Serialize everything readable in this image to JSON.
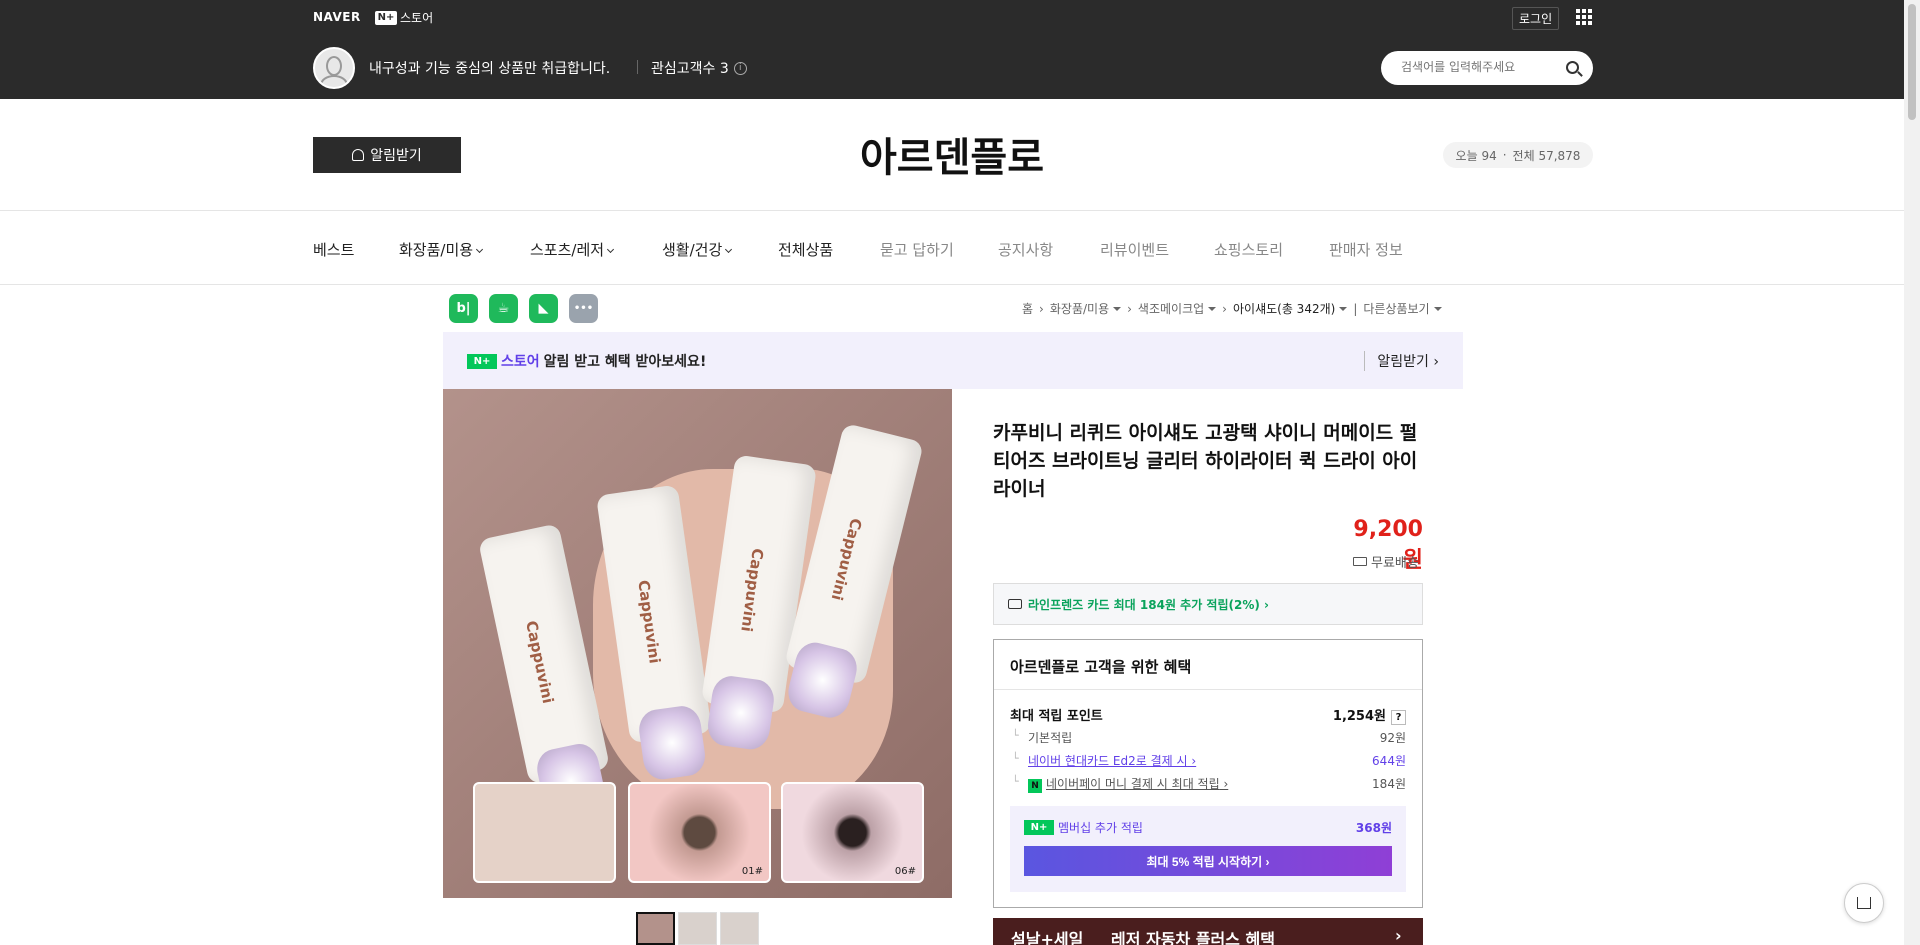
{
  "global": {
    "naver_label": "NAVER",
    "nplus_badge": "N+",
    "store_label": "스토어",
    "login_label": "로그인",
    "intro_text": "내구성과 기능 중심의 상품만 취급합니다.",
    "fans_text": "관심고객수 3",
    "search_placeholder": "검색어를 입력해주세요"
  },
  "store": {
    "notify_label": "알림받기",
    "name": "아르덴플로",
    "visits_today": "오늘 94",
    "visits_total": "전체 57,878"
  },
  "nav": [
    {
      "label": "베스트",
      "dropdown": false
    },
    {
      "label": "화장품/미용",
      "dropdown": true
    },
    {
      "label": "스포츠/레저",
      "dropdown": true
    },
    {
      "label": "생활/건강",
      "dropdown": true
    },
    {
      "label": "전체상품",
      "dropdown": false
    },
    {
      "label": "묻고 답하기",
      "dropdown": false
    },
    {
      "label": "공지사항",
      "dropdown": false
    },
    {
      "label": "리뷰이벤트",
      "dropdown": false
    },
    {
      "label": "쇼핑스토리",
      "dropdown": false
    },
    {
      "label": "판매자 정보",
      "dropdown": false
    }
  ],
  "share": [
    {
      "name": "band",
      "glyph": "b|",
      "color": "#1fb95b"
    },
    {
      "name": "cafe",
      "glyph": "☕",
      "color": "#1fb95b"
    },
    {
      "name": "blog",
      "glyph": "◣",
      "color": "#1fb95b"
    },
    {
      "name": "more",
      "glyph": "•••",
      "color": "#9aa3ad"
    }
  ],
  "breadcrumb": {
    "home": "홈",
    "cat1": "화장품/미용",
    "cat2": "색조메이크업",
    "cat3": "아이섀도(총 342개)",
    "other": "다른상품보기"
  },
  "banner": {
    "nplus": "N+",
    "store": "스토어",
    "text": "알림 받고 혜택 받아보세요!",
    "action": "알림받기 ›"
  },
  "image": {
    "brand": "Cappuvini",
    "inset_labels": [
      "",
      "01#",
      "06#"
    ]
  },
  "product": {
    "title": "카푸비니 리퀴드 아이섀도 고광택 샤이니 머메이드 펄 티어즈 브라이트닝 글리터 하이라이터 퀵 드라이 아이라이너",
    "price": "9,200원",
    "shipping": "무료배송",
    "card_offer": "라인프렌즈 카드 최대 184원 추가 적립(2%) ›"
  },
  "benefit": {
    "title": "아르덴플로 고객을 위한 혜택",
    "max_points_label": "최대 적립 포인트",
    "max_points_value": "1,254원",
    "help": "?",
    "basic_label": "기본적립",
    "basic_value": "92원",
    "card_label": "네이버 현대카드 Ed2로 결제 시",
    "card_value": "644원",
    "pay_label": "네이버페이 머니 결제 시 최대 적립",
    "pay_value": "184원",
    "n_badge": "N",
    "member_badge": "N+",
    "member_label": "멤버십 추가 적립",
    "member_value": "368원",
    "cta": "최대 5% 적립 시작하기 ›"
  },
  "promo": {
    "left": "설날+세일",
    "right": "레저 자동차 플러스 혜택",
    "arrow": "›"
  }
}
